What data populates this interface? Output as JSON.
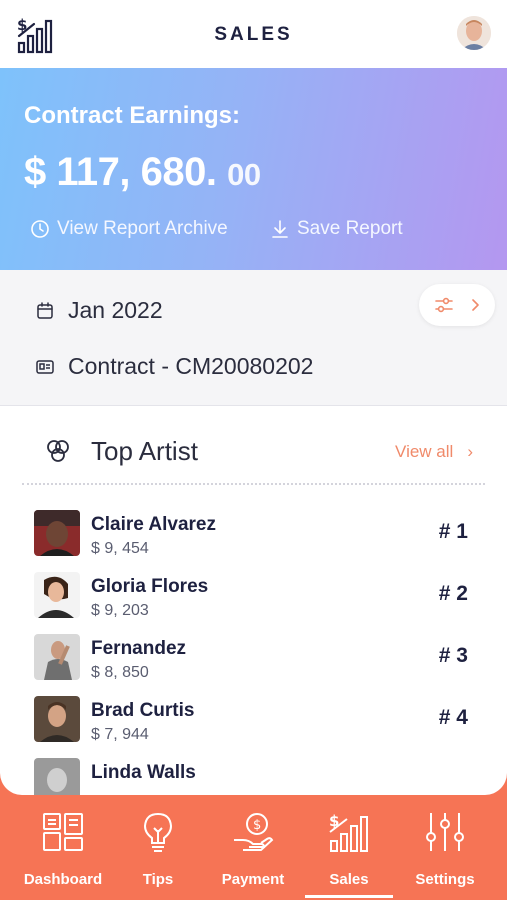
{
  "header": {
    "title": "SALES",
    "logo_icon": "sales-chart-icon",
    "avatar_icon": "user-avatar"
  },
  "earnings": {
    "label": "Contract Earnings:",
    "amount_main": "$ 117, 680.",
    "amount_cents": "00",
    "actions": [
      {
        "label": "View Report Archive",
        "icon": "clock-icon"
      },
      {
        "label": "Save Report",
        "icon": "download-icon"
      }
    ],
    "gradient": [
      "#7ec2fb",
      "#b497f0"
    ]
  },
  "filters": {
    "date": "Jan 2022",
    "contract": "Contract - CM20080202",
    "filter_button_icons": [
      "sliders-icon",
      "chevron-right-icon"
    ]
  },
  "top_artist": {
    "title": "Top Artist",
    "view_all": "View all",
    "items": [
      {
        "name": "Claire Alvarez",
        "value": "$ 9, 454",
        "rank": "# 1"
      },
      {
        "name": "Gloria Flores",
        "value": "$ 9, 203",
        "rank": "# 2"
      },
      {
        "name": "Fernandez",
        "value": "$ 8, 850",
        "rank": "# 3"
      },
      {
        "name": "Brad Curtis",
        "value": "$ 7, 944",
        "rank": "# 4"
      },
      {
        "name": "Linda Walls",
        "value": "",
        "rank": ""
      }
    ]
  },
  "nav": {
    "items": [
      {
        "label": "Dashboard",
        "icon": "dashboard-icon"
      },
      {
        "label": "Tips",
        "icon": "lightbulb-icon"
      },
      {
        "label": "Payment",
        "icon": "payment-icon"
      },
      {
        "label": "Sales",
        "icon": "sales-chart-icon"
      },
      {
        "label": "Settings",
        "icon": "settings-sliders-icon"
      }
    ],
    "active": "Sales",
    "accent": "#f67455"
  },
  "colors": {
    "primary_text": "#1e2140",
    "accent": "#f08a6a"
  }
}
